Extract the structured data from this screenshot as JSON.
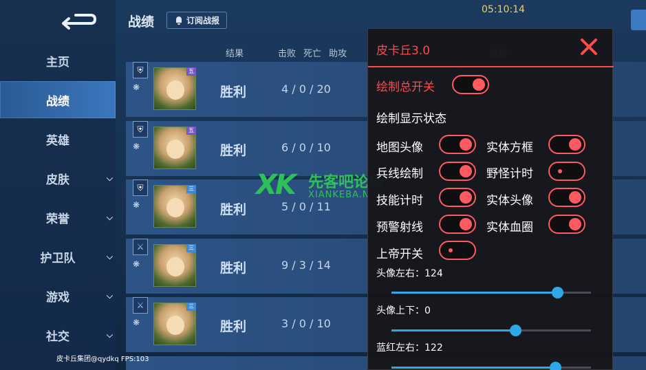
{
  "sidebar": {
    "items": [
      {
        "label": "主页",
        "has_chevron": false
      },
      {
        "label": "战绩",
        "has_chevron": false,
        "active": true
      },
      {
        "label": "英雄",
        "has_chevron": false
      },
      {
        "label": "皮肤",
        "has_chevron": true
      },
      {
        "label": "荣誉",
        "has_chevron": true
      },
      {
        "label": "护卫队",
        "has_chevron": true
      },
      {
        "label": "游戏",
        "has_chevron": true
      },
      {
        "label": "社交",
        "has_chevron": true
      }
    ],
    "footer": "皮卡丘集团@qydkq FPS:103"
  },
  "header": {
    "title": "战绩",
    "subscribe_label": "订阅战报",
    "clock": "05:10:14"
  },
  "columns": {
    "result": "结果",
    "kills": "击败",
    "deaths": "死亡",
    "assists": "助攻",
    "equip": "装备"
  },
  "rows": [
    {
      "result": "胜利",
      "kda": "4 / 0 / 20",
      "tier": "五"
    },
    {
      "result": "胜利",
      "kda": "6 / 0 / 10",
      "tier": "五"
    },
    {
      "result": "胜利",
      "kda": "5 / 0 / 11",
      "tier": "三"
    },
    {
      "result": "胜利",
      "kda": "9 / 3 / 14",
      "tier": "三"
    },
    {
      "result": "胜利",
      "kda": "3 / 0 / 10",
      "tier": "三"
    }
  ],
  "watermark": {
    "logo": "XK",
    "name": "先客吧论坛",
    "domain": "XIANKEBA.NET"
  },
  "panel": {
    "title": "皮卡丘3.0",
    "master_switch": {
      "label": "绘制总开关",
      "on": true
    },
    "section_label": "绘制显示状态",
    "toggles": [
      {
        "label": "地图头像",
        "on": true
      },
      {
        "label": "实体方框",
        "on": true
      },
      {
        "label": "兵线绘制",
        "on": true
      },
      {
        "label": "野怪计时",
        "on": false
      },
      {
        "label": "技能计时",
        "on": true
      },
      {
        "label": "实体头像",
        "on": true
      },
      {
        "label": "预警射线",
        "on": true
      },
      {
        "label": "实体血圈",
        "on": true
      },
      {
        "label": "上帝开关",
        "on": false
      }
    ],
    "sliders": [
      {
        "label": "头像左右：124",
        "fraction": 0.83
      },
      {
        "label": "头像上下：0",
        "fraction": 0.62
      },
      {
        "label": "蓝红左右：122",
        "fraction": 0.82
      }
    ]
  },
  "colors": {
    "accent_red": "#ff4a4a",
    "slider_blue": "#2fa8e8",
    "clock_yellow": "#f0d060",
    "watermark_green": "#2fc05a"
  }
}
